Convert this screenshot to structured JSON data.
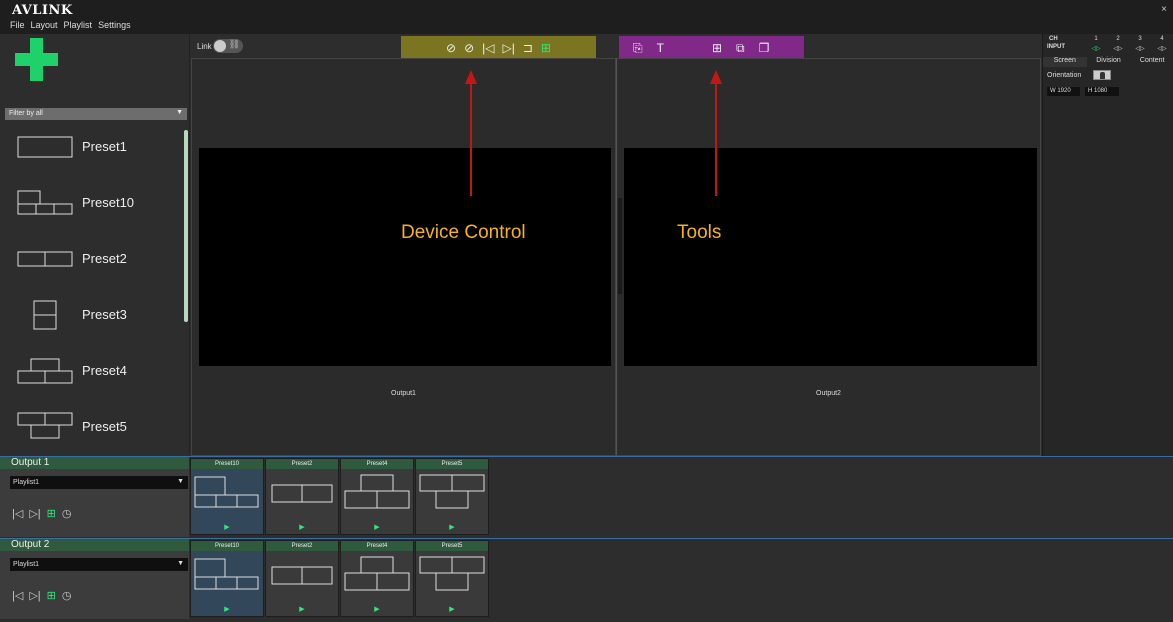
{
  "app": {
    "logo": "AVLINK",
    "close": "×"
  },
  "menu": [
    "File",
    "Layout",
    "Playlist",
    "Settings"
  ],
  "filter": {
    "value": "Filter by all"
  },
  "presets": [
    "Preset1",
    "Preset10",
    "Preset2",
    "Preset3",
    "Preset4",
    "Preset5"
  ],
  "toolbar": {
    "link_label": "Link",
    "device_control_icons": [
      "hide-icon",
      "hide-all-icon",
      "skip-back-icon",
      "skip-forward-icon",
      "loop-icon",
      "layout-grid-icon"
    ],
    "tools_icons": [
      "window-add-icon",
      "text-icon",
      "grid-icon",
      "sub-window-icon",
      "layers-icon"
    ]
  },
  "outputs": {
    "output1_label": "Output1",
    "output2_label": "Output2"
  },
  "annotations": {
    "device_control": "Device Control",
    "tools": "Tools"
  },
  "properties": {
    "ch_label": "CH",
    "input_label": "INPUT",
    "channels": [
      "1",
      "2",
      "3",
      "4"
    ],
    "tabs": [
      "Screen",
      "Division",
      "Content"
    ],
    "orientation_label": "Orientation",
    "width": "W 1920",
    "height": "H 1080"
  },
  "playlist_panels": [
    {
      "title": "Output 1",
      "playlist": "Playlist1",
      "cards": [
        "Preset10",
        "Preset2",
        "Preset4",
        "Preset5"
      ]
    },
    {
      "title": "Output 2",
      "playlist": "Playlist1",
      "cards": [
        "Preset10",
        "Preset2",
        "Preset4",
        "Preset5"
      ]
    }
  ],
  "colors": {
    "accent_green": "#1fd16a",
    "device_control_highlight": "#968c1e",
    "tools_highlight": "#9628a0",
    "annotation_text": "#f5b31e",
    "annotation_arrow": "#c21717"
  }
}
